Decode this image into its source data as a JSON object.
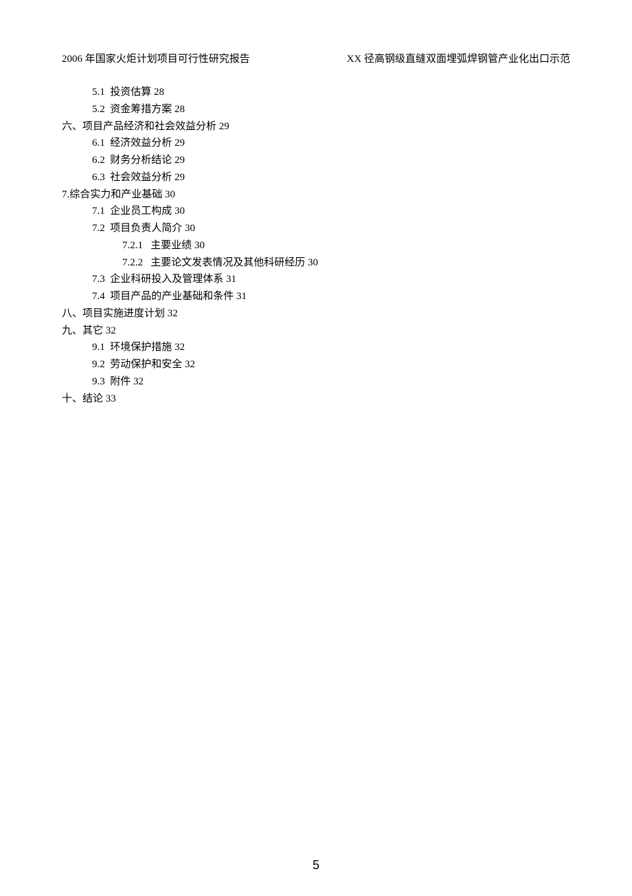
{
  "header": {
    "left": "2006 年国家火炬计划项目可行性研究报告",
    "right": "XX 径高钢级直缝双面埋弧焊钢管产业化出口示范"
  },
  "toc": [
    {
      "level": 2,
      "text": "5.1  投资估算 28"
    },
    {
      "level": 2,
      "text": "5.2  资金筹措方案 28"
    },
    {
      "level": 1,
      "text": "六、项目产品经济和社会效益分析 29"
    },
    {
      "level": 2,
      "text": "6.1  经济效益分析 29"
    },
    {
      "level": 2,
      "text": "6.2  财务分析结论 29"
    },
    {
      "level": 2,
      "text": "6.3  社会效益分析 29"
    },
    {
      "level": 1,
      "text": "7.综合实力和产业基础 30"
    },
    {
      "level": 2,
      "text": "7.1  企业员工构成 30"
    },
    {
      "level": 2,
      "text": "7.2  项目负责人简介 30"
    },
    {
      "level": 3,
      "text": "7.2.1   主要业绩 30"
    },
    {
      "level": 3,
      "text": "7.2.2   主要论文发表情况及其他科研经历 30"
    },
    {
      "level": 2,
      "text": "7.3  企业科研投入及管理体系 31"
    },
    {
      "level": 2,
      "text": "7.4  项目产品的产业基础和条件 31"
    },
    {
      "level": 1,
      "text": "八、项目实施进度计划 32"
    },
    {
      "level": 1,
      "text": "九、其它 32"
    },
    {
      "level": 2,
      "text": "9.1  环境保护措施 32"
    },
    {
      "level": 2,
      "text": "9.2  劳动保护和安全 32"
    },
    {
      "level": 2,
      "text": "9.3  附件 32"
    },
    {
      "level": 1,
      "text": "十、结论 33"
    }
  ],
  "page_number": "5"
}
